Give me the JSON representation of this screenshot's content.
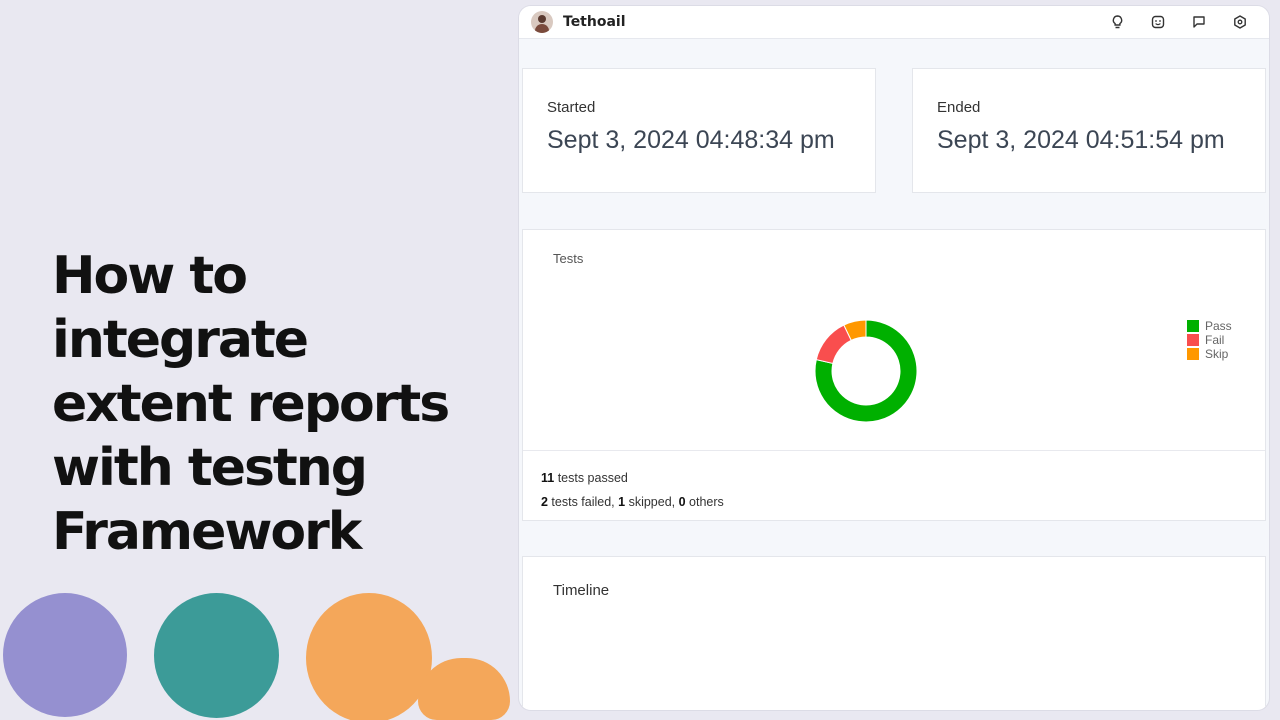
{
  "headline": {
    "lines": [
      "How to integrate",
      "extent reports",
      "with testng",
      "Framework"
    ]
  },
  "app": {
    "title": "Tethoail",
    "icons": [
      "lightbulb-icon",
      "emoji-icon",
      "chat-icon",
      "settings-icon"
    ]
  },
  "started": {
    "label": "Started",
    "value": "Sept 3, 2024 04:48:34 pm"
  },
  "ended": {
    "label": "Ended",
    "value": "Sept 3, 2024 04:51:54 pm"
  },
  "tests": {
    "title": "Tests",
    "summary": {
      "passed_count": "11",
      "passed_text": " tests passed",
      "failed_count": "2",
      "failed_text": " tests failed, ",
      "skipped_count": "1",
      "skipped_text": " skipped, ",
      "others_count": "0",
      "others_text": " others"
    }
  },
  "timeline": {
    "title": "Timeline"
  },
  "colors": {
    "pass": "#00b000",
    "fail": "#f94e4e",
    "skip": "#ff9800"
  },
  "chart_data": {
    "type": "pie",
    "categories": [
      "Pass",
      "Fail",
      "Skip"
    ],
    "values": [
      11,
      2,
      1
    ],
    "colors": [
      "#00b000",
      "#f94e4e",
      "#ff9800"
    ],
    "title": "Tests",
    "legend": "right"
  }
}
